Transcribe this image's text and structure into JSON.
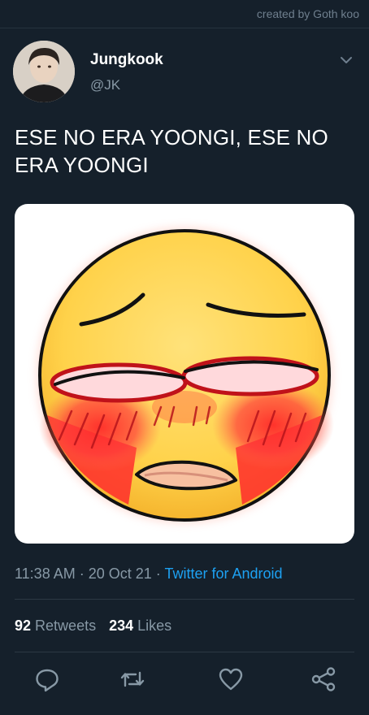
{
  "watermark": "created by Goth koo",
  "tweet": {
    "display_name": "Jungkook",
    "handle": "@JK",
    "text": "ESE NO ERA YOONGI, ESE NO ERA YOONGI",
    "time": "11:38 AM",
    "separator": " · ",
    "date": "20 Oct 21",
    "source": "Twitter for Android",
    "retweets_count": "92",
    "retweets_label": "Retweets",
    "likes_count": "234",
    "likes_label": "Likes"
  },
  "icons": {
    "caret": "chevron-down-icon",
    "reply": "reply-icon",
    "retweet": "retweet-icon",
    "like": "heart-icon",
    "share": "share-icon"
  },
  "colors": {
    "background": "#15202b",
    "secondary_text": "#8899a6",
    "link": "#1da1f2"
  }
}
